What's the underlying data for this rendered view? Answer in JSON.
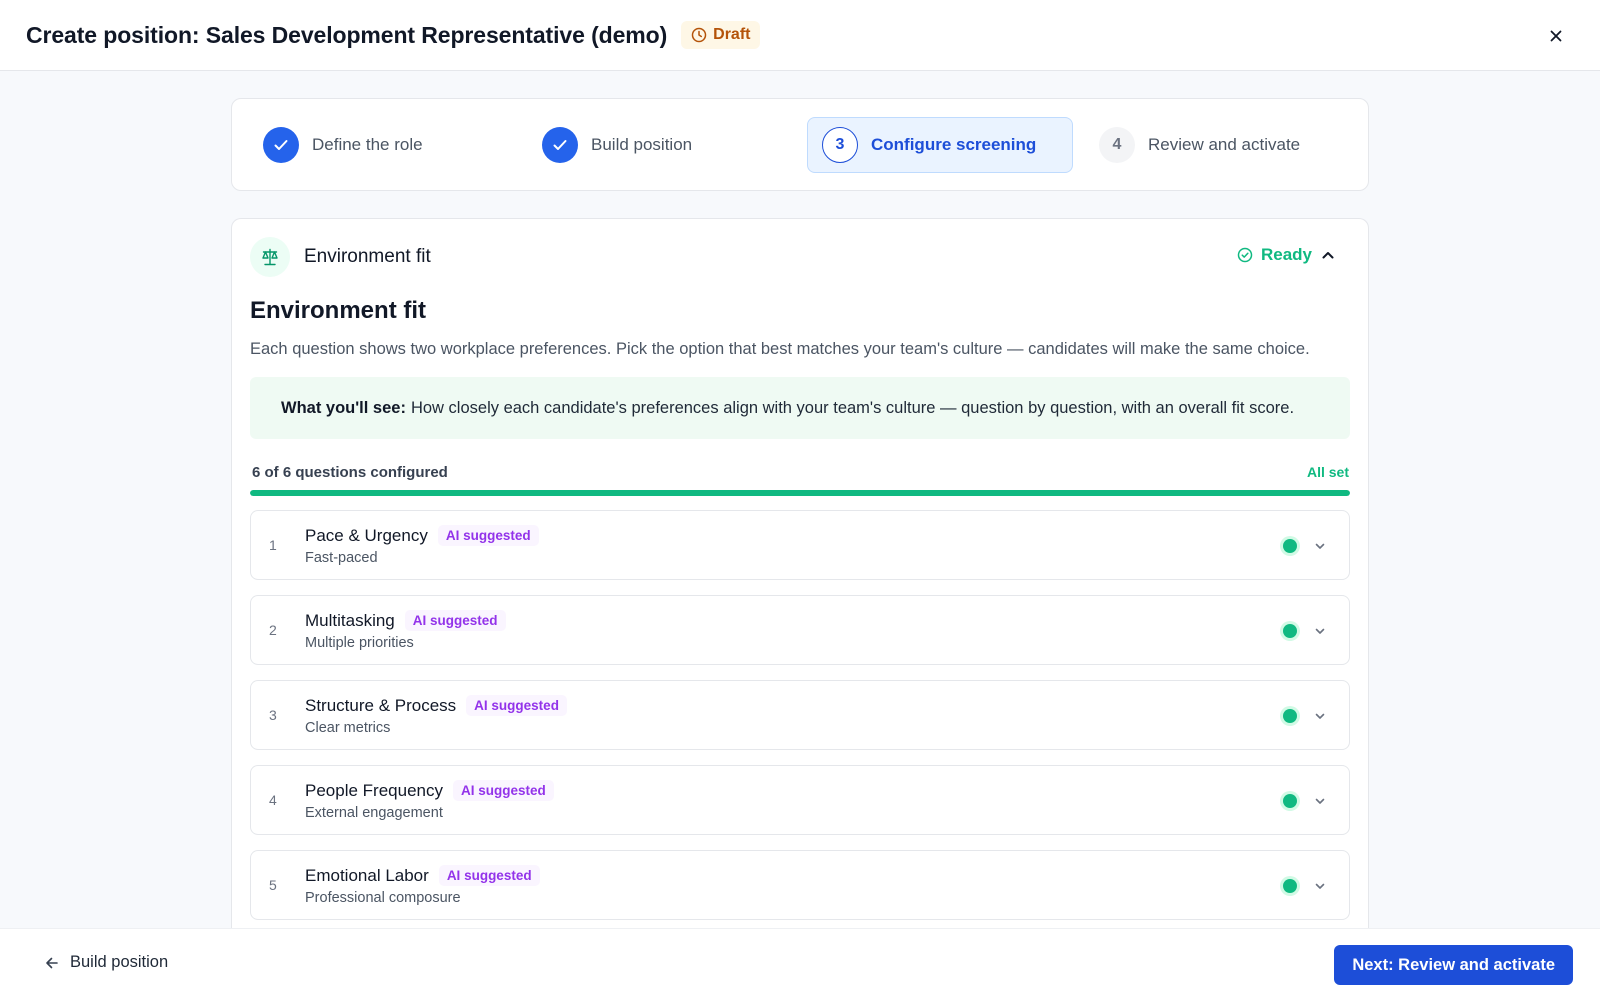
{
  "header": {
    "title": "Create position: Sales Development Representative (demo)",
    "draft_label": "Draft",
    "close_icon": "close-icon"
  },
  "stepper": {
    "steps": [
      {
        "number": "1",
        "label": "Define the role",
        "state": "completed"
      },
      {
        "number": "2",
        "label": "Build position",
        "state": "completed"
      },
      {
        "number": "3",
        "label": "Configure screening",
        "state": "current"
      },
      {
        "number": "4",
        "label": "Review and activate",
        "state": "upcoming"
      }
    ]
  },
  "card": {
    "header_title": "Environment fit",
    "status": "Ready",
    "section_title": "Environment fit",
    "description": "Each question shows two workplace preferences. Pick the option that best matches your team's culture — candidates will make the same choice.",
    "info_label": "What you'll see:",
    "info_text": "How closely each candidate's preferences align with your team's culture — question by question, with an overall fit score.",
    "progress_label": "6 of 6 questions configured",
    "progress_status": "All set",
    "progress_fraction": 1.0,
    "questions": [
      {
        "number": "1",
        "title": "Pace & Urgency",
        "badge": "AI suggested",
        "subtitle": "Fast-paced"
      },
      {
        "number": "2",
        "title": "Multitasking",
        "badge": "AI suggested",
        "subtitle": "Multiple priorities"
      },
      {
        "number": "3",
        "title": "Structure & Process",
        "badge": "AI suggested",
        "subtitle": "Clear metrics"
      },
      {
        "number": "4",
        "title": "People Frequency",
        "badge": "AI suggested",
        "subtitle": "External engagement"
      },
      {
        "number": "5",
        "title": "Emotional Labor",
        "badge": "AI suggested",
        "subtitle": "Professional composure"
      }
    ]
  },
  "footer": {
    "back_label": "Build position",
    "next_label": "Next: Review and activate"
  },
  "colors": {
    "accent": "#1d4ed8",
    "success": "#10b981",
    "ai_badge": "#9333ea",
    "draft": "#b45309"
  }
}
